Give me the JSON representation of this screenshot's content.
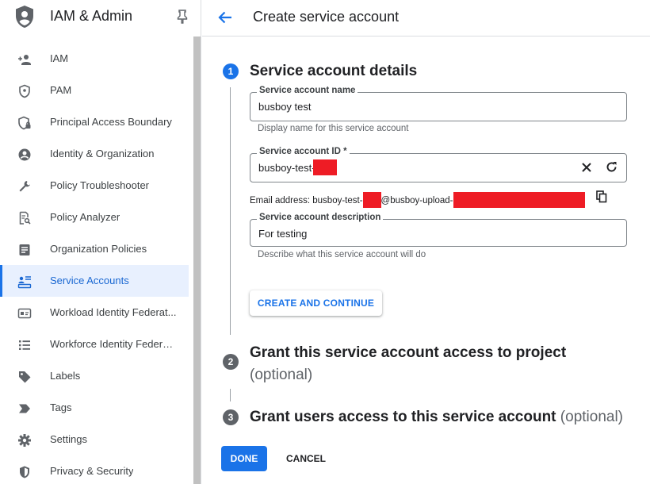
{
  "app": {
    "title": "IAM & Admin",
    "logo_icon": "shield-person-icon",
    "pin_icon": "pin-icon"
  },
  "sidebar": {
    "items": [
      {
        "label": "IAM",
        "icon": "person-add-icon",
        "active": false
      },
      {
        "label": "PAM",
        "icon": "shield-icon",
        "active": false
      },
      {
        "label": "Principal Access Boundary",
        "icon": "shield-lock-icon",
        "active": false
      },
      {
        "label": "Identity & Organization",
        "icon": "account-circle-icon",
        "active": false
      },
      {
        "label": "Policy Troubleshooter",
        "icon": "wrench-icon",
        "active": false
      },
      {
        "label": "Policy Analyzer",
        "icon": "document-search-icon",
        "active": false
      },
      {
        "label": "Organization Policies",
        "icon": "list-doc-icon",
        "active": false
      },
      {
        "label": "Service Accounts",
        "icon": "service-account-icon",
        "active": true
      },
      {
        "label": "Workload Identity Federat...",
        "icon": "id-card-icon",
        "active": false
      },
      {
        "label": "Workforce Identity Federa...",
        "icon": "list-icon",
        "active": false
      },
      {
        "label": "Labels",
        "icon": "tag-icon",
        "active": false
      },
      {
        "label": "Tags",
        "icon": "chevron-tag-icon",
        "active": false
      },
      {
        "label": "Settings",
        "icon": "gear-icon",
        "active": false
      },
      {
        "label": "Privacy & Security",
        "icon": "shield-icon",
        "active": false
      }
    ]
  },
  "header": {
    "title": "Create service account",
    "back_icon": "arrow-back-icon"
  },
  "steps": {
    "step1": {
      "number": "1",
      "title": "Service account details",
      "name_field": {
        "label": "Service account name",
        "value": "busboy test",
        "hint": "Display name for this service account"
      },
      "id_field": {
        "label": "Service account ID *",
        "value": "busboy-test-"
      },
      "email": {
        "prefix": "Email address: busboy-test-",
        "middle": "@busboy-upload-"
      },
      "description_field": {
        "label": "Service account description",
        "value": "For testing",
        "hint": "Describe what this service account will do"
      },
      "continue_label": "CREATE AND CONTINUE"
    },
    "step2": {
      "number": "2",
      "title": "Grant this service account access to project",
      "optional": "(optional)"
    },
    "step3": {
      "number": "3",
      "title": "Grant users access to this service account",
      "optional": "(optional)"
    }
  },
  "actions": {
    "done_label": "DONE",
    "cancel_label": "CANCEL"
  },
  "colors": {
    "accent": "#1a73e8",
    "active_bg": "#e8f0fe",
    "step_inactive": "#5f6368",
    "redaction": "#ee1c25"
  }
}
